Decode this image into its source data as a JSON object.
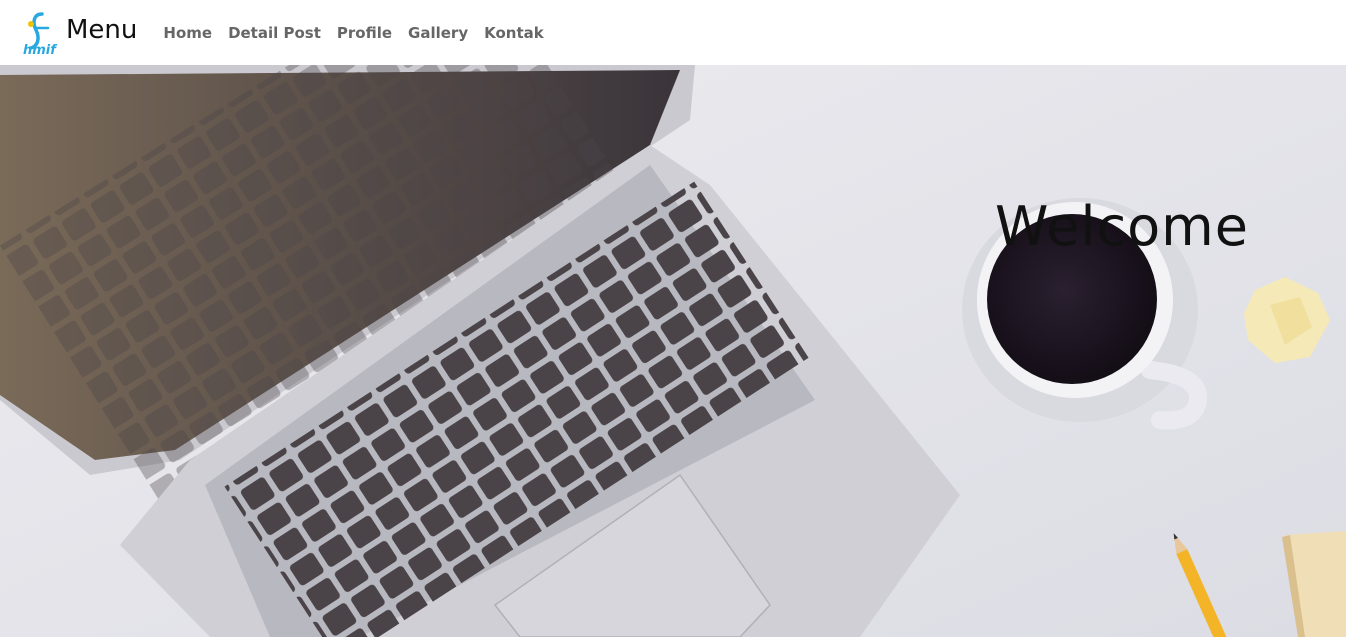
{
  "logo": {
    "text": "hmif"
  },
  "navbar": {
    "brand": "Menu",
    "links": [
      "Home",
      "Detail Post",
      "Profile",
      "Gallery",
      "Kontak"
    ]
  },
  "hero": {
    "heading": "Welcome",
    "image": "workspace-desk-photo"
  },
  "colors": {
    "logo_accent": "#29a8e0",
    "nav_text": "#666666",
    "brand_text": "#111111",
    "hero_bg": "#e4e4ea"
  }
}
